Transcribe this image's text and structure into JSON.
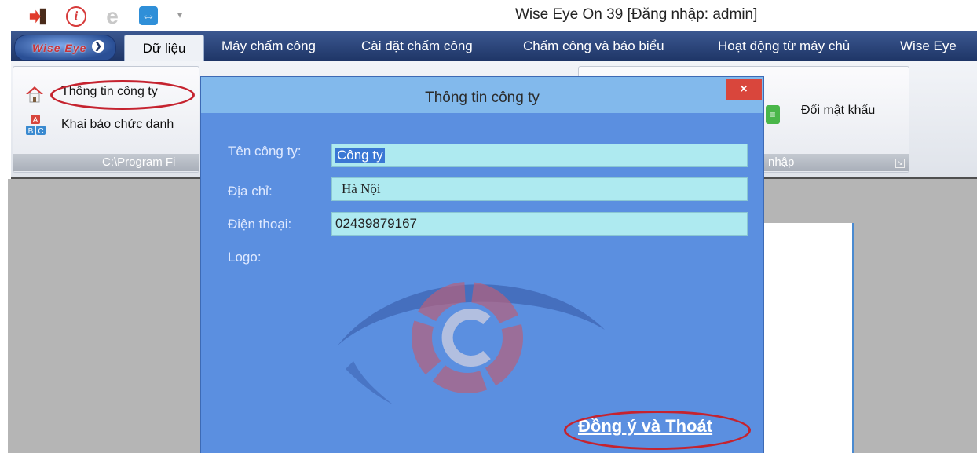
{
  "window": {
    "title": "Wise Eye On 39 [Đăng nhập: admin]"
  },
  "quick_access": [
    {
      "icon": "exit-icon"
    },
    {
      "icon": "info-icon",
      "glyph": "i"
    },
    {
      "icon": "ie-browser-icon",
      "glyph": "e"
    },
    {
      "icon": "teamviewer-icon",
      "glyph": "⇔"
    },
    {
      "icon": "customize-dropdown-icon",
      "glyph": "▾"
    }
  ],
  "app_button": {
    "label": "Wise Eye",
    "chevron": "❯"
  },
  "tabs": [
    {
      "label": "Dữ liệu",
      "active": true
    },
    {
      "label": "Máy chấm công"
    },
    {
      "label": "Cài đặt chấm công"
    },
    {
      "label": "Chấm công và báo biểu"
    },
    {
      "label": "Hoạt động từ máy chủ"
    },
    {
      "label": "Wise Eye"
    }
  ],
  "ribbon": {
    "group1": {
      "items": [
        {
          "label": "Thông tin công ty",
          "icon": "house-icon"
        },
        {
          "label": "Khai báo chức danh",
          "icon": "abc-blocks-icon"
        }
      ],
      "footer": "C:\\Program Fi"
    },
    "group2": {
      "items": [
        {
          "label": "Đổi mật khẩu",
          "icon": "change-password-icon"
        }
      ],
      "footer": "nhập"
    }
  },
  "dialog": {
    "title": "Thông tin công ty",
    "close_glyph": "×",
    "fields": {
      "name": {
        "label": "Tên công ty:",
        "value": "Công ty"
      },
      "address": {
        "label": "Địa chỉ:",
        "value": "Hà Nội"
      },
      "phone": {
        "label": "Điện thoại:",
        "value": "02439879167"
      },
      "logo": {
        "label": "Logo:"
      }
    },
    "ok_button": "Đồng ý và Thoát"
  },
  "colors": {
    "ribbon_tab_bg": "#2a4578",
    "dialog_bg": "#5b8fe0",
    "dialog_titlebar": "#82b9ec",
    "field_bg": "#aeeaf0",
    "highlight_ring": "#c5232f",
    "close_button": "#d9463c"
  }
}
